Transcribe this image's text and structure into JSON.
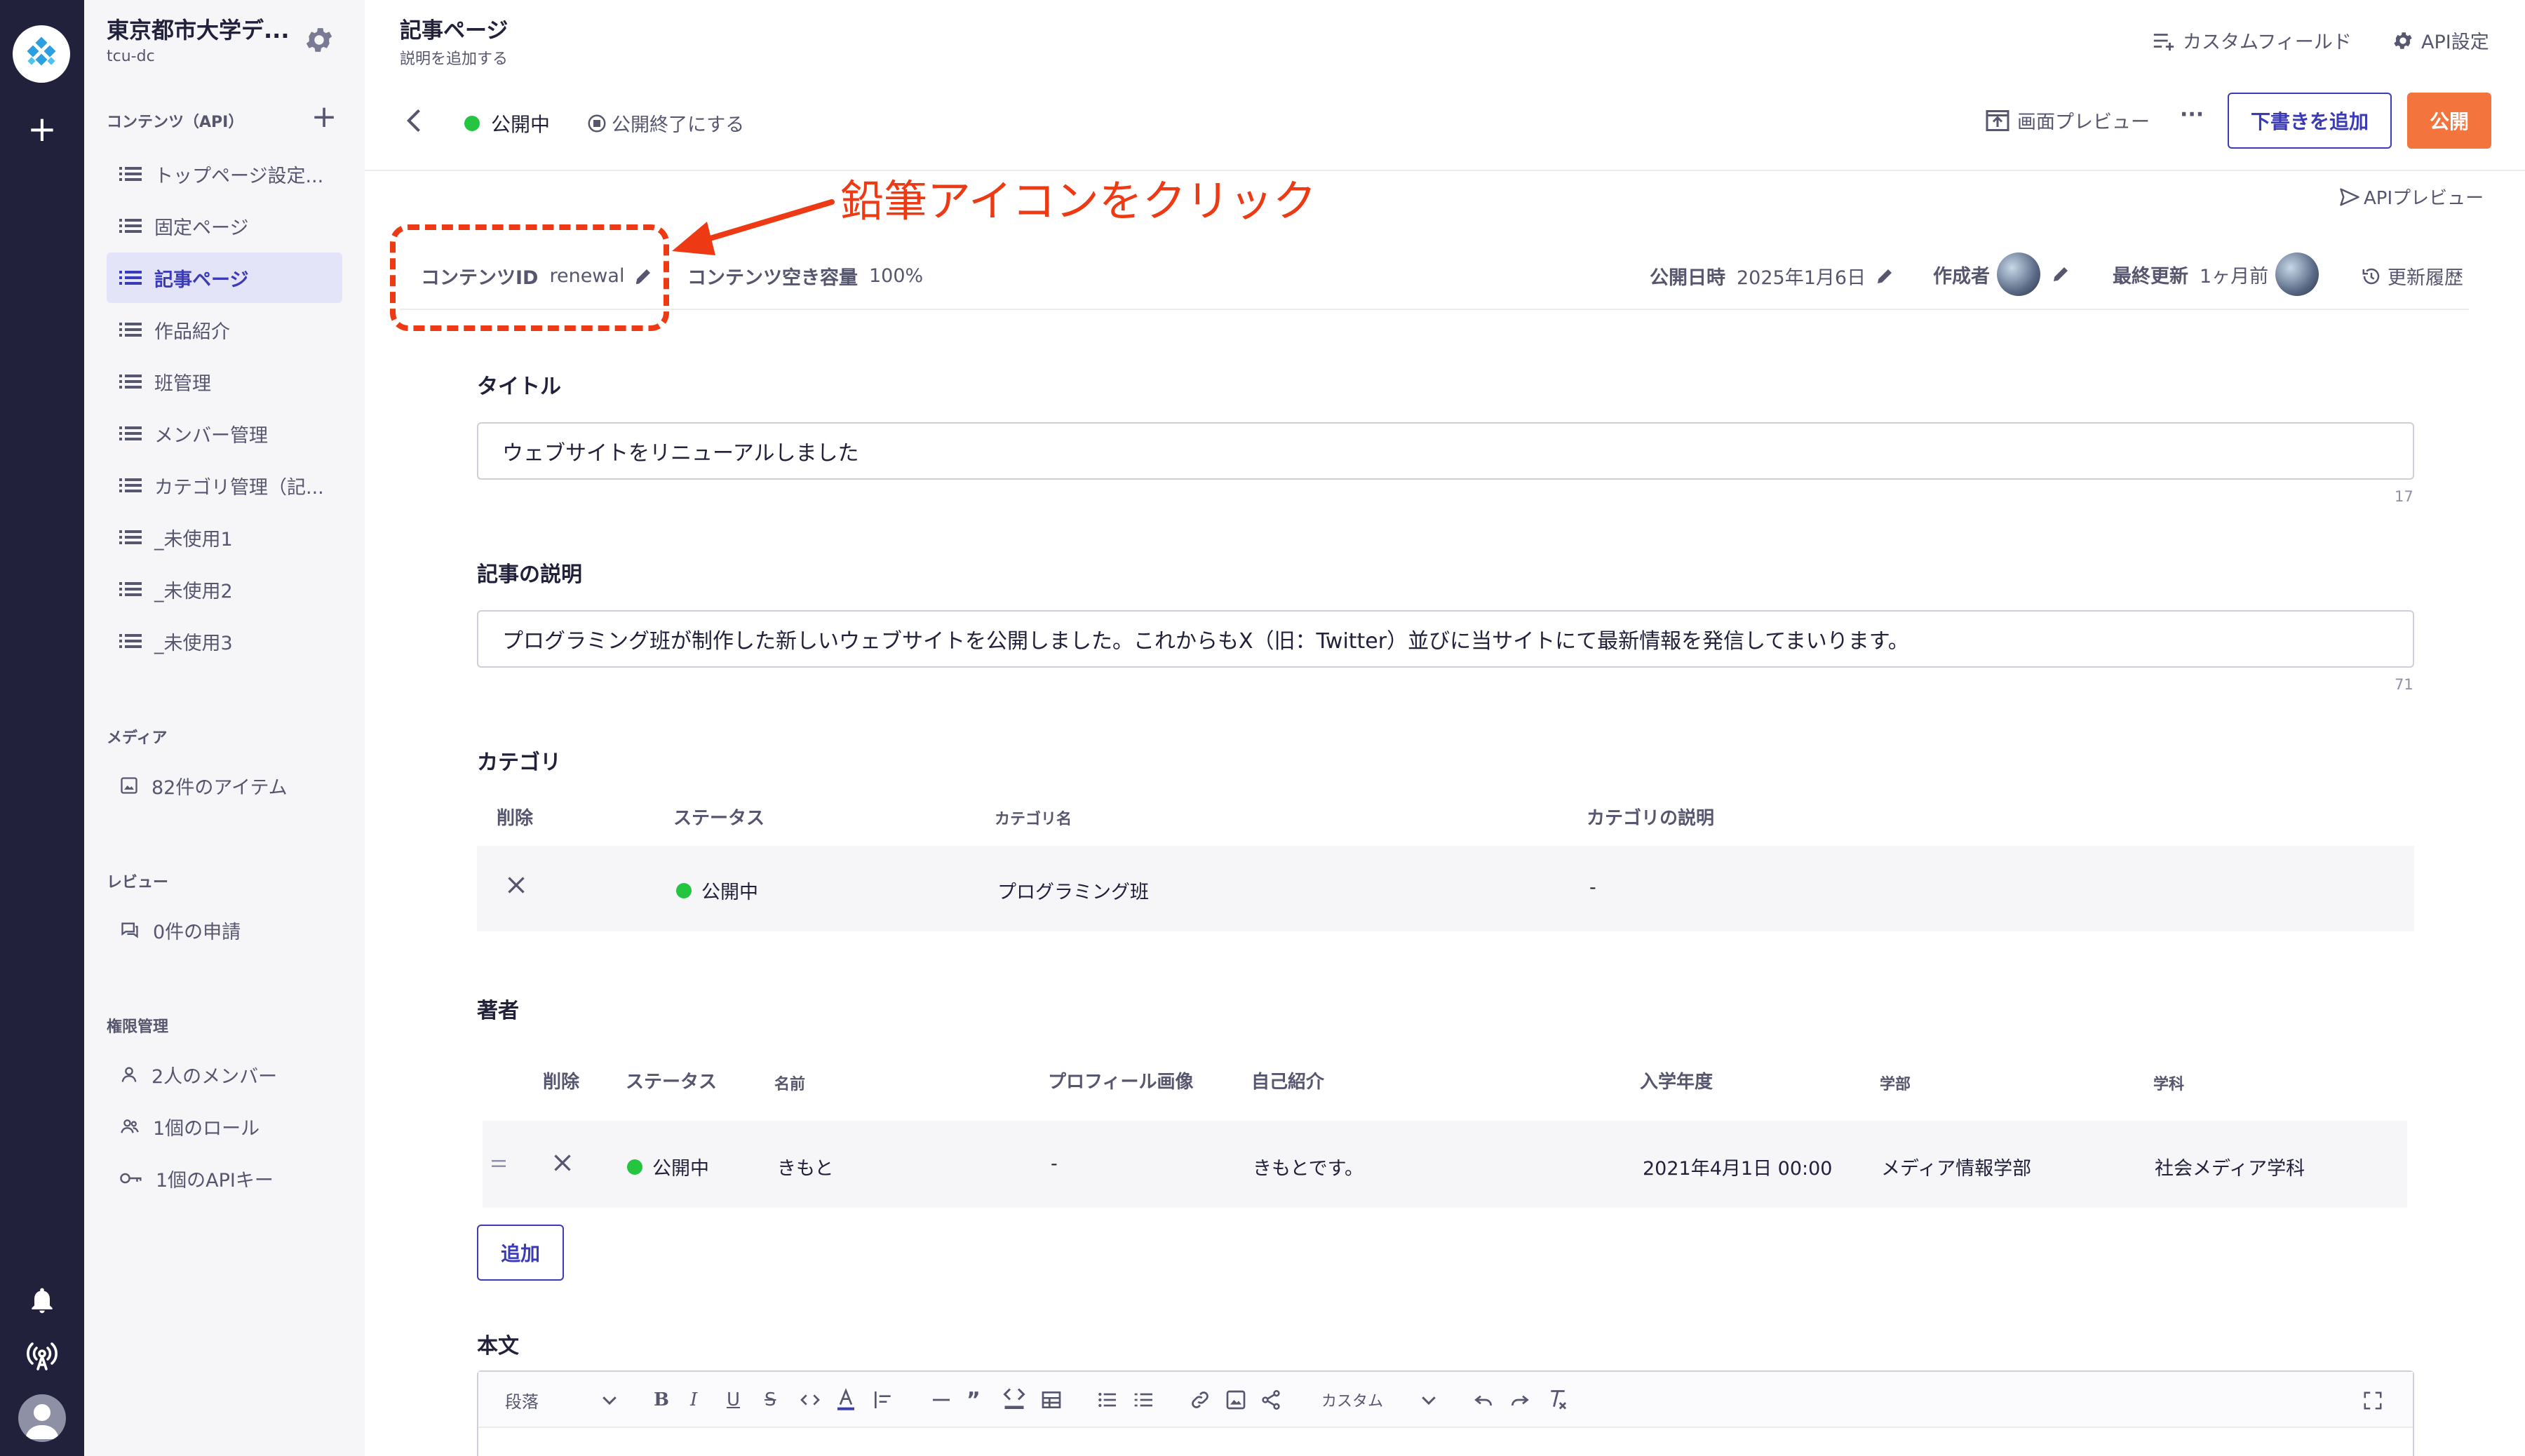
{
  "sidebar": {
    "service_name": "東京都市大学デ...",
    "service_id": "tcu-dc",
    "contents_section": "コンテンツ（API）",
    "items": [
      {
        "label": "トップページ設定..."
      },
      {
        "label": "固定ページ"
      },
      {
        "label": "記事ページ"
      },
      {
        "label": "作品紹介"
      },
      {
        "label": "班管理"
      },
      {
        "label": "メンバー管理"
      },
      {
        "label": "カテゴリ管理（記..."
      },
      {
        "label": "_未使用1"
      },
      {
        "label": "_未使用2"
      },
      {
        "label": "_未使用3"
      }
    ],
    "media_section": "メディア",
    "media_item": "82件のアイテム",
    "review_section": "レビュー",
    "review_item": "0件の申請",
    "auth_section": "権限管理",
    "auth_items": [
      {
        "label": "2人のメンバー"
      },
      {
        "label": "1個のロール"
      },
      {
        "label": "1個のAPIキー"
      }
    ]
  },
  "header": {
    "title": "記事ページ",
    "subtitle": "説明を追加する",
    "custom_field": "カスタムフィールド",
    "api_settings": "API設定"
  },
  "toolbar": {
    "status": "公開中",
    "unpublish": "公開終了にする",
    "preview": "画面プレビュー",
    "more": "···",
    "add_draft": "下書きを追加",
    "publish": "公開",
    "api_preview": "APIプレビュー"
  },
  "meta": {
    "content_id_label": "コンテンツID",
    "content_id": "renewal",
    "capacity_label": "コンテンツ空き容量",
    "capacity": "100%",
    "published_label": "公開日時",
    "published": "2025年1月6日",
    "author_label": "作成者",
    "updated_label": "最終更新",
    "updated": "1ヶ月前",
    "history": "更新履歴"
  },
  "annotation": {
    "text": "鉛筆アイコンをクリック"
  },
  "fields": {
    "title_label": "タイトル",
    "title_value": "ウェブサイトをリニューアルしました",
    "title_count": "17",
    "desc_label": "記事の説明",
    "desc_value": "プログラミング班が制作した新しいウェブサイトを公開しました。これからもX（旧：Twitter）並びに当サイトにて最新情報を発信してまいります。",
    "desc_count": "71",
    "category_label": "カテゴリ",
    "category_headers": [
      "削除",
      "ステータス",
      "カテゴリ名",
      "カテゴリの説明"
    ],
    "category_row": {
      "status": "公開中",
      "name": "プログラミング班",
      "desc": "-"
    },
    "author_label": "著者",
    "author_headers": [
      "削除",
      "ステータス",
      "名前",
      "プロフィール画像",
      "自己紹介",
      "入学年度",
      "学部",
      "学科"
    ],
    "author_row": {
      "status": "公開中",
      "name": "きもと",
      "image": "-",
      "intro": "きもとです。",
      "year": "2021年4月1日 00:00",
      "faculty": "メディア情報学部",
      "dept": "社会メディア学科"
    },
    "add_button": "追加",
    "body_label": "本文",
    "editor_paragraph": "段落",
    "editor_custom": "カスタム"
  }
}
